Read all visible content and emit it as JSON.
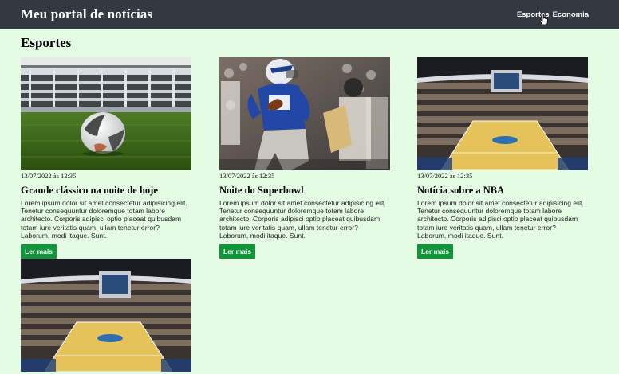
{
  "header": {
    "brand": "Meu portal de notícias",
    "nav": [
      {
        "label": "Esportes"
      },
      {
        "label": "Economia"
      }
    ]
  },
  "section": {
    "title": "Esportes"
  },
  "articles": [
    {
      "image": "soccer-ball-stadium",
      "date": "13/07/2022 às 12:35",
      "title": "Grande clássico na noite de hoje",
      "excerpt": "Lorem ipsum dolor sit amet consectetur adipisicing elit. Tenetur consequuntur doloremque totam labore architecto. Corporis adipisci optio placeat quibusdam totam iure veritatis quam, ullam tenetur error? Laborum, modi itaque. Sunt.",
      "button": "Ler mais"
    },
    {
      "image": "american-football-player",
      "date": "13/07/2022 às 12:35",
      "title": "Noite do Superbowl",
      "excerpt": "Lorem ipsum dolor sit amet consectetur adipisicing elit. Tenetur consequuntur doloremque totam labore architecto. Corporis adipisci optio placeat quibusdam totam iure veritatis quam, ullam tenetur error? Laborum, modi itaque. Sunt.",
      "button": "Ler mais"
    },
    {
      "image": "basketball-arena",
      "date": "13/07/2022 às 12:35",
      "title": "Notícia sobre a NBA",
      "excerpt": "Lorem ipsum dolor sit amet consectetur adipisicing elit. Tenetur consequuntur doloremque totam labore architecto. Corporis adipisci optio placeat quibusdam totam iure veritatis quam, ullam tenetur error? Laborum, modi itaque. Sunt.",
      "button": "Ler mais"
    },
    {
      "image": "basketball-arena"
    }
  ],
  "colors": {
    "header_bg": "#333841",
    "page_bg": "#e4fce4",
    "button_bg": "#11953a"
  }
}
